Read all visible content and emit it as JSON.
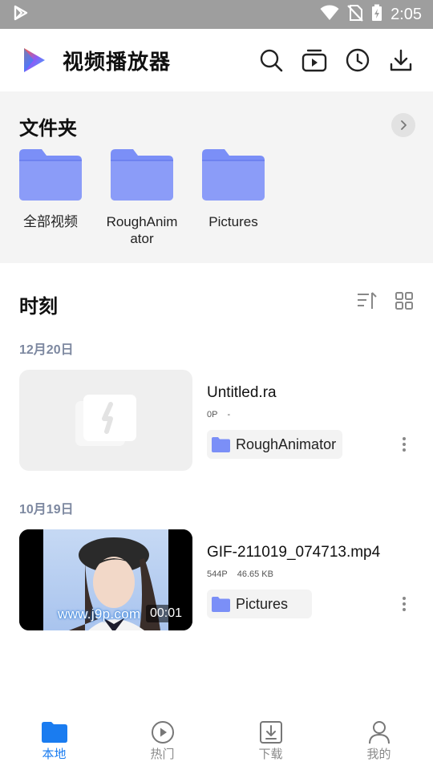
{
  "status_bar": {
    "time": "2:05",
    "icons": [
      "play-store-icon",
      "wifi-icon",
      "no-sim-icon",
      "battery-charging-icon"
    ]
  },
  "header": {
    "app_title": "视频播放器",
    "actions": [
      "search-icon",
      "video-library-icon",
      "history-icon",
      "download-icon"
    ]
  },
  "folders": {
    "title": "文件夹",
    "items": [
      {
        "label": "全部视频"
      },
      {
        "label": "RoughAnimator"
      },
      {
        "label": "Pictures"
      }
    ]
  },
  "moments": {
    "title": "时刻",
    "groups": [
      {
        "date": "12月20日",
        "video": {
          "name": "Untitled.ra",
          "resolution": "0P",
          "size": "-",
          "folder": "RoughAnimator",
          "duration": ""
        }
      },
      {
        "date": "10月19日",
        "video": {
          "name": "GIF-211019_074713.mp4",
          "resolution": "544P",
          "size": "46.65 KB",
          "folder": "Pictures",
          "duration": "00:01",
          "watermark": "www.j9p.com"
        }
      }
    ]
  },
  "bottom_nav": {
    "items": [
      {
        "label": "本地",
        "icon": "folder-icon",
        "active": true
      },
      {
        "label": "热门",
        "icon": "play-circle-icon",
        "active": false
      },
      {
        "label": "下载",
        "icon": "download-box-icon",
        "active": false
      },
      {
        "label": "我的",
        "icon": "user-icon",
        "active": false
      }
    ]
  },
  "colors": {
    "accent": "#1a7cf0",
    "folder": "#7b8ff7",
    "date_text": "#7d88a0",
    "status_bar": "#9e9e9e"
  }
}
